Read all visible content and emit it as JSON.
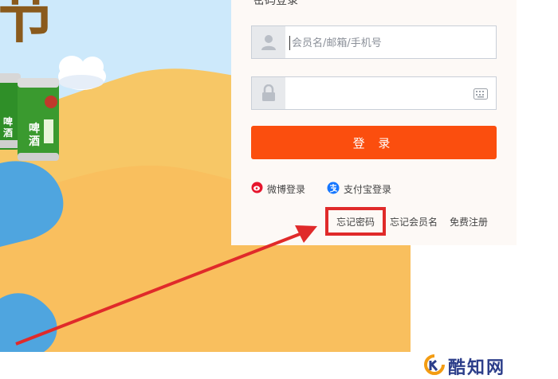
{
  "banner": {
    "festival_char": "节",
    "can_label_a": "啤酒",
    "can_label_b": "啤酒"
  },
  "login": {
    "title": "密码登录",
    "username_placeholder": "会员名/邮箱/手机号",
    "password_value": "",
    "login_button": "登 录",
    "weibo_login": "微博登录",
    "alipay_login": "支付宝登录",
    "forgot_password": "忘记密码",
    "forgot_member": "忘记会员名",
    "register": "免费注册"
  },
  "colors": {
    "primary_button": "#fb4e0e",
    "highlight_box": "#e02a2a",
    "annotation_arrow": "#e02a2a"
  },
  "watermark": {
    "text": "酷知网"
  }
}
